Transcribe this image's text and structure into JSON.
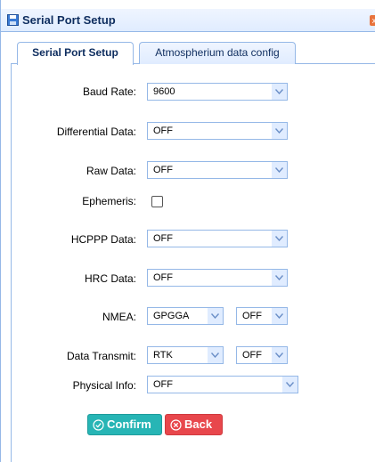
{
  "dialog": {
    "title": "Serial Port Setup",
    "close_glyph": "x"
  },
  "tabs": [
    {
      "label": "Serial Port Setup",
      "active": true
    },
    {
      "label": "Atmospherium data config",
      "active": false
    }
  ],
  "form": {
    "baud_rate": {
      "label": "Baud Rate:",
      "value": "9600"
    },
    "differential_data": {
      "label": "Differential Data:",
      "value": "OFF"
    },
    "raw_data": {
      "label": "Raw Data:",
      "value": "OFF"
    },
    "ephemeris": {
      "label": "Ephemeris:",
      "checked": false
    },
    "hcppp_data": {
      "label": "HCPPP Data:",
      "value": "OFF"
    },
    "hrc_data": {
      "label": "HRC Data:",
      "value": "OFF"
    },
    "nmea": {
      "label": "NMEA:",
      "type_value": "GPGGA",
      "rate_value": "OFF"
    },
    "data_transmit": {
      "label": "Data Transmit:",
      "type_value": "RTK",
      "rate_value": "OFF"
    },
    "physical_info": {
      "label": "Physical Info:",
      "value": "OFF"
    }
  },
  "buttons": {
    "confirm": "Confirm",
    "back": "Back"
  },
  "colors": {
    "accent": "#95b8e7",
    "confirm": "#27b5b5",
    "back": "#e8474c",
    "title": "#0e2d5f"
  },
  "icons": {
    "title": "save-disk-icon",
    "confirm": "check-circle-icon",
    "back": "x-circle-icon",
    "dropdown": "chevron-down-icon"
  }
}
